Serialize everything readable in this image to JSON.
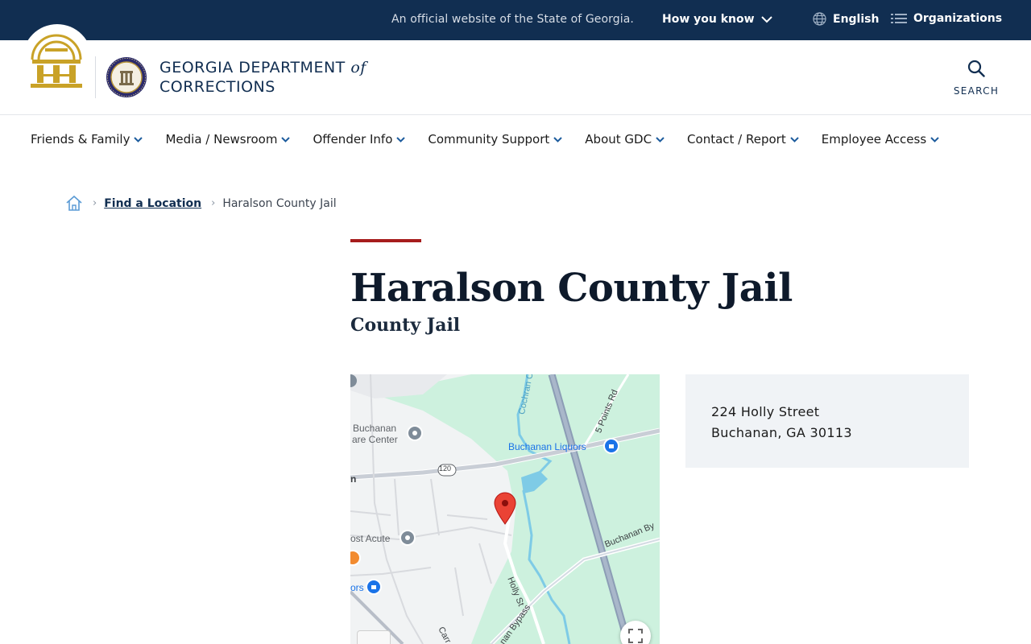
{
  "topbar": {
    "official_text": "An official website of the State of Georgia.",
    "how_you_know": "How you know",
    "language": "English",
    "organizations": "Organizations"
  },
  "header": {
    "dept_name_line1": "GEORGIA DEPARTMENT",
    "dept_name_of": "of",
    "dept_name_line2": "CORRECTIONS",
    "search_label": "SEARCH"
  },
  "nav": {
    "items": [
      {
        "label": "Friends & Family"
      },
      {
        "label": "Media / Newsroom"
      },
      {
        "label": "Offender Info"
      },
      {
        "label": "Community Support"
      },
      {
        "label": "About GDC"
      },
      {
        "label": "Contact / Report"
      },
      {
        "label": "Employee Access"
      }
    ]
  },
  "breadcrumb": {
    "link": "Find a Location",
    "current": "Haralson County Jail"
  },
  "page": {
    "title": "Haralson County Jail",
    "subtitle": "County Jail"
  },
  "map": {
    "labels": {
      "buchanan_care_1": "Buchanan",
      "buchanan_care_2": "are Center",
      "buchanan_liquors": "Buchanan Liquors",
      "post_acute": "ost Acute",
      "ors": "ors",
      "route_120": "120",
      "five_points": "5 Points Rd",
      "cochran": "Cochran C",
      "buchanan_bypass_right": "Buchanan By",
      "holly_st": "Holly St",
      "buchanan_bypass": "nan Bypass",
      "carr": "Carr",
      "n_left": "n"
    }
  },
  "address": {
    "street": "224 Holly Street",
    "city_state_zip": "Buchanan, GA 30113"
  },
  "colors": {
    "topbar_bg": "#112e51",
    "accent_red": "#a61c1c",
    "chevron_blue": "#1d5c9d",
    "address_bg": "#f0f3f6"
  }
}
